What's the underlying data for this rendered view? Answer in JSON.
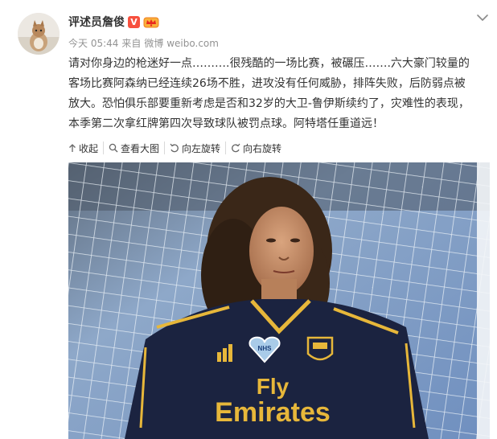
{
  "post": {
    "author": {
      "name": "评述员詹俊",
      "vip_mark": "V"
    },
    "meta": {
      "time": "今天 05:44",
      "from_prefix": "来自",
      "source": "微博 weibo.com"
    },
    "text_lines": [
      "请对你身边的枪迷好一点……….很残酷的一场比赛，被碾压…….六大豪门较量的",
      "客场比赛阿森纳已经连续26场不胜，进攻没有任何威胁，排阵失败，后防弱点被",
      "放大。恐怕俱乐部要重新考虑是否和32岁的大卫-鲁伊斯续约了，灾难性的表现，",
      "本季第二次拿红牌第四次导致球队被罚点球。阿特塔任重道远！"
    ],
    "toolbar": {
      "collapse": "收起",
      "view_large": "查看大图",
      "rotate_left": "向左旋转",
      "rotate_right": "向右旋转"
    },
    "photo": {
      "jersey_sponsor_line1": "Fly",
      "jersey_sponsor_line2": "Emirates",
      "badge_text": "NHS",
      "colors": {
        "jersey": "#1b2340",
        "trim": "#e7b73a",
        "net_background": "#7f9dc4"
      }
    }
  },
  "icons": {
    "menu": "chevron-down-icon",
    "collapse": "arrow-up-icon",
    "view_large": "magnifier-icon",
    "rotate_left": "rotate-left-icon",
    "rotate_right": "rotate-right-icon"
  }
}
